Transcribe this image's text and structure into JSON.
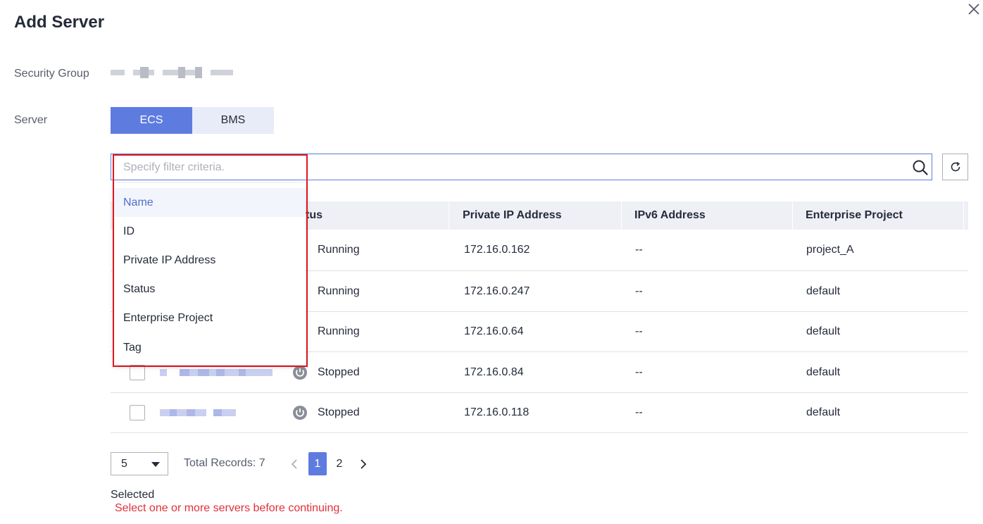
{
  "dialog": {
    "title": "Add Server"
  },
  "form": {
    "security_group_label": "Security Group",
    "server_label": "Server"
  },
  "server_type_tabs": [
    {
      "label": "ECS",
      "active": true
    },
    {
      "label": "BMS",
      "active": false
    }
  ],
  "search": {
    "placeholder": "Specify filter criteria.",
    "value": ""
  },
  "filter_dropdown": {
    "items": [
      "Name",
      "ID",
      "Private IP Address",
      "Status",
      "Enterprise Project",
      "Tag"
    ],
    "active_item": "Name"
  },
  "table": {
    "columns": [
      "tus",
      "Private IP Address",
      "IPv6 Address",
      "Enterprise Project"
    ],
    "rows": [
      {
        "status": "Running",
        "private_ip": "172.16.0.162",
        "ipv6": "--",
        "project": "project_A"
      },
      {
        "status": "Running",
        "private_ip": "172.16.0.247",
        "ipv6": "--",
        "project": "default"
      },
      {
        "status": "Running",
        "private_ip": "172.16.0.64",
        "ipv6": "--",
        "project": "default"
      },
      {
        "status": "Stopped",
        "private_ip": "172.16.0.84",
        "ipv6": "--",
        "project": "default"
      },
      {
        "status": "Stopped",
        "private_ip": "172.16.0.118",
        "ipv6": "--",
        "project": "default"
      }
    ]
  },
  "pagination": {
    "page_size": "5",
    "total_records": "Total Records: 7",
    "pages": [
      "1",
      "2"
    ],
    "current_page": "1"
  },
  "selection": {
    "label": "Selected",
    "error": "Select one or more servers before continuing."
  },
  "colors": {
    "accent": "#5e7ce0",
    "error": "#e0313a",
    "highlight": "#e0161e"
  },
  "icons": [
    "close-icon",
    "search-icon",
    "refresh-icon",
    "power-icon",
    "chevron-left-icon",
    "chevron-right-icon",
    "caret-down-icon"
  ]
}
